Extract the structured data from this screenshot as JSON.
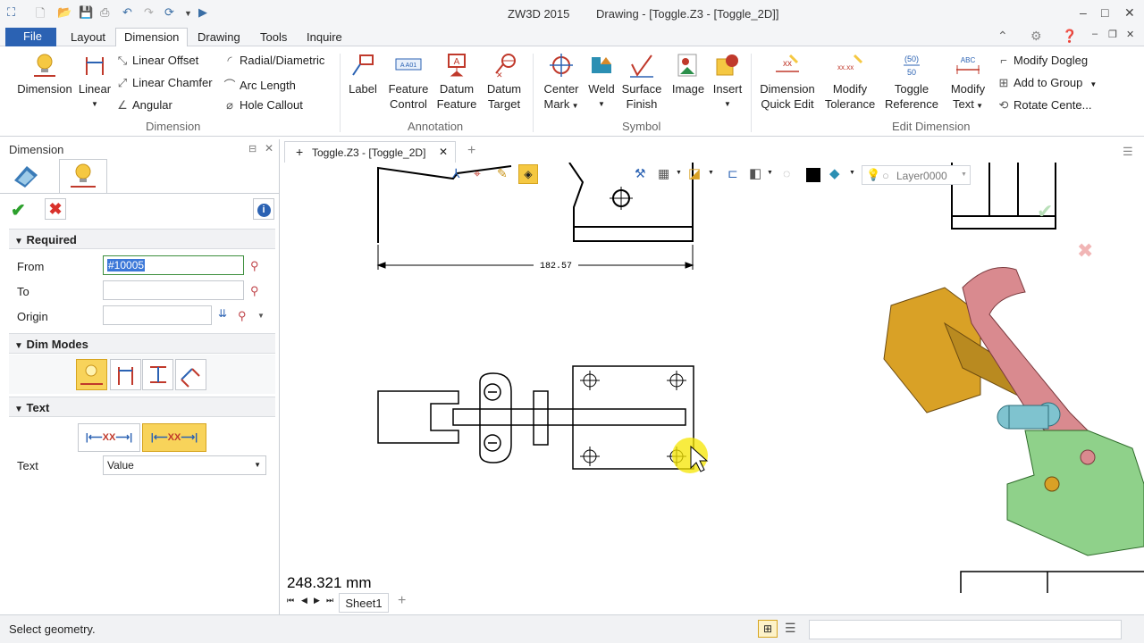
{
  "titlebar": {
    "app": "ZW3D 2015",
    "document": "Drawing - [Toggle.Z3 - [Toggle_2D]]"
  },
  "menu": {
    "file": "File",
    "tabs": [
      "Layout",
      "Dimension",
      "Drawing",
      "Tools",
      "Inquire"
    ]
  },
  "ribbon": {
    "dimension_group": {
      "dimension": "Dimension",
      "linear": "Linear",
      "linear_offset": "Linear Offset",
      "linear_chamfer": "Linear Chamfer",
      "angular": "Angular",
      "radial": "Radial/Diametric",
      "arc_length": "Arc Length",
      "hole_callout": "Hole Callout",
      "group_label": "Dimension"
    },
    "annotation_group": {
      "label": "Label",
      "feature_control": [
        "Feature",
        "Control"
      ],
      "datum_feature": [
        "Datum",
        "Feature"
      ],
      "datum_target": [
        "Datum",
        "Target"
      ],
      "group_label": "Annotation",
      "icon_text": "A A01"
    },
    "symbol_group": {
      "center_mark": [
        "Center",
        "Mark"
      ],
      "weld": "Weld",
      "surface_finish": [
        "Surface",
        "Finish"
      ],
      "image": "Image",
      "insert": "Insert",
      "group_label": "Symbol"
    },
    "edit_group": {
      "quick_edit": [
        "Dimension",
        "Quick Edit"
      ],
      "modify_tolerance": [
        "Modify",
        "Tolerance"
      ],
      "toggle_reference": [
        "Toggle",
        "Reference"
      ],
      "modify_text": [
        "Modify",
        "Text"
      ],
      "modify_dogleg": "Modify Dogleg",
      "add_to_group": "Add to Group",
      "rotate_center": "Rotate Cente...",
      "group_label": "Edit Dimension",
      "ref_icon_top": "(50)",
      "ref_icon_bottom": "50",
      "abc_icon": "ABC",
      "tol_icon": "xx.xx"
    }
  },
  "panel": {
    "title": "Dimension",
    "required": "Required",
    "from_label": "From",
    "from_value": "#10005",
    "to_label": "To",
    "origin_label": "Origin",
    "dim_modes": "Dim Modes",
    "text_section": "Text",
    "text_label": "Text",
    "text_value": "Value",
    "text_icon": "XX"
  },
  "viewport": {
    "tab": "Toggle.Z3 - [Toggle_2D]",
    "layer": "Layer0000",
    "dimension_value": "182.57",
    "measurement": "248.321 mm",
    "sheet": "Sheet1"
  },
  "status": {
    "message": "Select geometry."
  },
  "colors": {
    "accent": "#2b62b3",
    "yellow": "#f5c842",
    "part_orange": "#d9a126",
    "part_pink": "#d98a8f",
    "part_green": "#8fd18a",
    "part_teal": "#7fc3cf"
  }
}
